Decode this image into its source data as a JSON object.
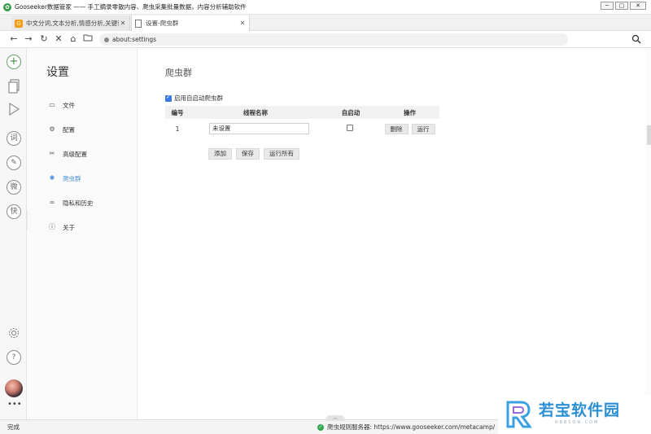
{
  "window": {
    "title": "Gooseeker数据管家 —— 手工摘录零散内容、爬虫采集批量数据，内容分析辅助软件",
    "controls": [
      "─",
      "▢",
      "✕"
    ]
  },
  "tabs": [
    {
      "label": "中文分词,文本分析,情感分析,关键词抽",
      "favicon": "G"
    },
    {
      "label": "设置-爬虫群"
    }
  ],
  "navbar": {
    "url": "about:settings"
  },
  "rail": {
    "items": [
      {
        "name": "add",
        "glyph": "+"
      },
      {
        "name": "page",
        "glyph": ""
      },
      {
        "name": "play",
        "glyph": ""
      },
      {
        "name": "ci",
        "glyph": "词"
      },
      {
        "name": "edit",
        "glyph": "✎"
      },
      {
        "name": "wei",
        "glyph": "微"
      },
      {
        "name": "kuai",
        "glyph": "快"
      }
    ],
    "more": "•••"
  },
  "settings_nav": {
    "title": "设置",
    "items": [
      {
        "label": "文件",
        "icon": "folder-icon"
      },
      {
        "label": "配置",
        "icon": "gear-icon"
      },
      {
        "label": "高级配置",
        "icon": "tools-icon"
      },
      {
        "label": "爬虫群",
        "icon": "bug-icon",
        "active": true
      },
      {
        "label": "隐私和历史",
        "icon": "mask-icon"
      },
      {
        "label": "关于",
        "icon": "info-icon"
      }
    ]
  },
  "content": {
    "title": "爬虫群",
    "enable_label": "启用自启动爬虫群",
    "enable_checked": true,
    "table": {
      "headers": [
        "编号",
        "线程名称",
        "自启动",
        "操作"
      ],
      "rows": [
        {
          "id": "1",
          "name": "未设置",
          "autostart": false,
          "delete": "删除",
          "run": "运行"
        }
      ]
    },
    "buttons": {
      "add": "添加",
      "save": "保存",
      "run_all": "运行所有"
    }
  },
  "status": {
    "left": "完成",
    "server_label": "爬虫规则服务器: https://www.gooseeker.com/metacamp/"
  },
  "watermark": {
    "text": "若宝软件园",
    "sub": "RBBSON.COM"
  }
}
